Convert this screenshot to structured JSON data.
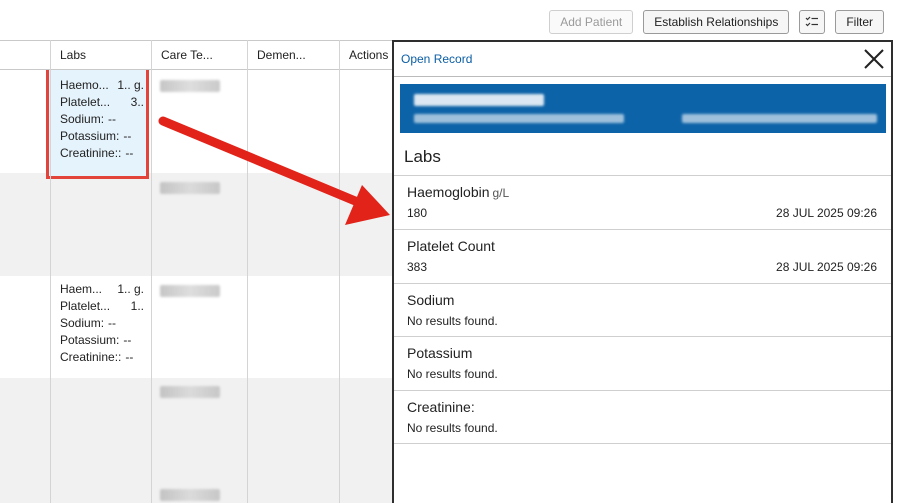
{
  "toolbar": {
    "add_patient": "Add Patient",
    "establish_relationships": "Establish Relationships",
    "filter": "Filter"
  },
  "table": {
    "headers": [
      "Labs",
      "Care Te...",
      "Demen...",
      "Actions"
    ],
    "rows": [
      {
        "labs": [
          {
            "name": "Haemo...",
            "value": "1.. g."
          },
          {
            "name": "Platelet...",
            "value": "3.."
          },
          {
            "name": "Sodium:",
            "value": "--"
          },
          {
            "name": "Potassium:",
            "value": "--"
          },
          {
            "name": "Creatinine::",
            "value": "--"
          }
        ]
      },
      {
        "labs": [
          {
            "name": "Haem...",
            "value": "1.. g."
          },
          {
            "name": "Platelet...",
            "value": "1.."
          },
          {
            "name": "Sodium:",
            "value": "--"
          },
          {
            "name": "Potassium:",
            "value": "--"
          },
          {
            "name": "Creatinine::",
            "value": "--"
          }
        ]
      }
    ]
  },
  "panel": {
    "open_record": "Open Record",
    "title": "Labs",
    "labs": [
      {
        "name": "Haemoglobin",
        "unit": "g/L",
        "value": "180",
        "time": "28 JUL 2025 09:26"
      },
      {
        "name": "Platelet Count",
        "unit": "",
        "value": "383",
        "time": "28 JUL 2025 09:26"
      },
      {
        "name": "Sodium",
        "unit": "",
        "value": "No results found.",
        "time": ""
      },
      {
        "name": "Potassium",
        "unit": "",
        "value": "No results found.",
        "time": ""
      },
      {
        "name": "Creatinine:",
        "unit": "",
        "value": "No results found.",
        "time": ""
      }
    ]
  },
  "colors": {
    "accent_blue": "#0d63a8",
    "highlight_border": "#e2443c",
    "arrow": "#e2231a",
    "selected_cell": "#e5f3fc"
  }
}
